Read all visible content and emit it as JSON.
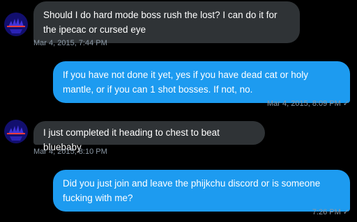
{
  "conversation": {
    "messages": [
      {
        "direction": "in",
        "text": "Should I do hard mode boss rush the lost? I can do it for the ipecac or cursed eye",
        "timestamp": "Mar 4, 2015, 7:44 PM"
      },
      {
        "direction": "out",
        "text": "If you have not done it yet, yes if you have dead cat or holy mantle, or if you can 1 shot bosses. If not, no.",
        "timestamp": "Mar 4, 2015, 8:09 PM",
        "status_icon": "checkmark-icon"
      },
      {
        "direction": "in",
        "text": "I just completed it heading to chest to beat bluebaby",
        "timestamp": "Mar 4, 2015, 8:10 PM"
      },
      {
        "direction": "out",
        "text": "Did you just join and leave the phijkchu discord or is someone fucking with me?",
        "timestamp": "7:26 PM",
        "status_icon": "checkmark-icon"
      }
    ],
    "check_glyph": "✓"
  },
  "colors": {
    "background": "#000000",
    "incoming_bubble": "#2f3336",
    "outgoing_bubble": "#1d9bf0",
    "timestamp_text": "#8b98a5"
  }
}
